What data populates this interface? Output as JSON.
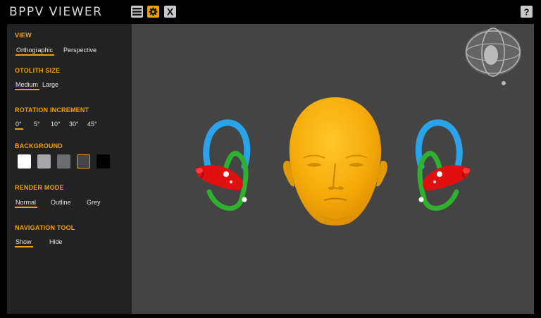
{
  "app": {
    "title": "BPPV VIEWER"
  },
  "toolbar": {
    "menu_icon": "menu-icon",
    "settings_icon": "gear-icon",
    "close_icon": "close-icon",
    "help_icon": "help-icon",
    "close_glyph": "X",
    "help_glyph": "?"
  },
  "settings": {
    "view": {
      "title": "VIEW",
      "options": [
        "Orthographic",
        "Perspective"
      ],
      "selected": "Orthographic"
    },
    "otolith_size": {
      "title": "OTOLITH SIZE",
      "options": [
        "Medium",
        "Large"
      ],
      "selected": "Medium"
    },
    "rotation_increment": {
      "title": "ROTATION INCREMENT",
      "options": [
        "0°",
        "5°",
        "10°",
        "30°",
        "45°"
      ],
      "selected": "0°"
    },
    "background": {
      "title": "BACKGROUND",
      "swatches": [
        "#ffffff",
        "#a6a7ab",
        "#6c6d70",
        "#454545",
        "#000000"
      ],
      "selected": "#454545"
    },
    "render_mode": {
      "title": "RENDER MODE",
      "options": [
        "Normal",
        "Outline",
        "Grey"
      ],
      "selected": "Normal"
    },
    "navigation_tool": {
      "title": "NAVIGATION TOOL",
      "options": [
        "Show",
        "Hide"
      ],
      "selected": "Show"
    }
  },
  "colors": {
    "accent": "#f0a000",
    "head": "#f5b00f",
    "anterior_canal": "#2aa3e8",
    "posterior_canal": "#2fb02f",
    "horizontal_canal": "#e01010",
    "viewport_bg": "#444444",
    "panel_bg": "#222222"
  }
}
